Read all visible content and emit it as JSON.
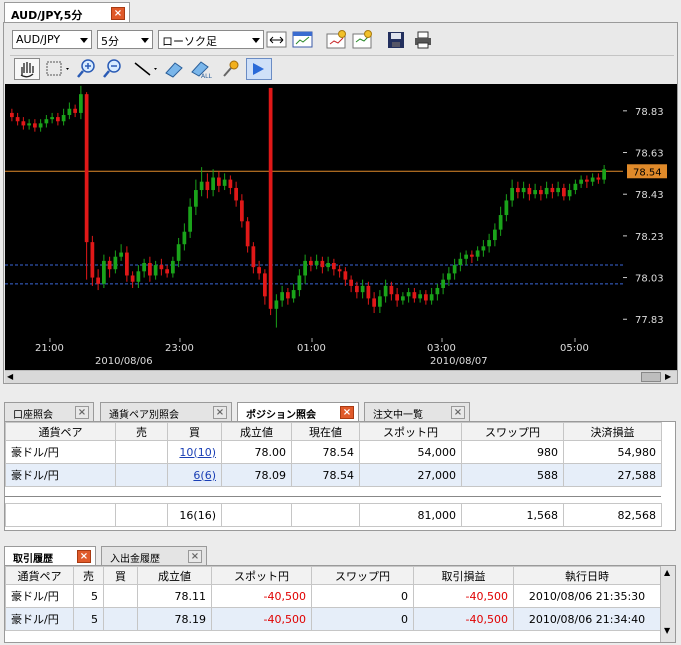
{
  "chart_window": {
    "tab_label": "AUD/JPY,5分",
    "pair_select": "AUD/JPY",
    "interval_select": "5分",
    "chart_type_select": "ローソク足",
    "price_axis_labels": [
      "78.83",
      "78.63",
      "78.43",
      "78.23",
      "78.03",
      "77.83"
    ],
    "current_price_label": "78.54",
    "time_labels": [
      "21:00",
      "23:00",
      "01:00",
      "03:00",
      "05:00"
    ],
    "date_labels": [
      "2010/08/06",
      "2010/08/07"
    ]
  },
  "chart_data": {
    "type": "candlestick",
    "ylim": [
      77.74,
      78.93
    ],
    "current_price": 78.54,
    "reference_lines": [
      78.09,
      78.0
    ],
    "candles": [
      [
        78.82,
        78.8,
        78.84,
        78.78
      ],
      [
        78.8,
        78.78,
        78.82,
        78.76
      ],
      [
        78.78,
        78.76,
        78.8,
        78.74
      ],
      [
        78.76,
        78.77,
        78.79,
        78.74
      ],
      [
        78.77,
        78.75,
        78.79,
        78.73
      ],
      [
        78.75,
        78.77,
        78.79,
        78.73
      ],
      [
        78.77,
        78.79,
        78.81,
        78.75
      ],
      [
        78.79,
        78.8,
        78.82,
        78.77
      ],
      [
        78.8,
        78.78,
        78.82,
        78.76
      ],
      [
        78.78,
        78.81,
        78.84,
        78.76
      ],
      [
        78.81,
        78.84,
        78.87,
        78.79
      ],
      [
        78.84,
        78.82,
        78.86,
        78.8
      ],
      [
        78.82,
        78.91,
        78.95,
        78.79
      ],
      [
        78.91,
        78.2,
        78.92,
        78.02
      ],
      [
        78.2,
        78.03,
        78.23,
        77.99
      ],
      [
        78.03,
        78.0,
        78.07,
        77.97
      ],
      [
        78.0,
        78.11,
        78.14,
        77.98
      ],
      [
        78.11,
        78.07,
        78.13,
        78.03
      ],
      [
        78.07,
        78.13,
        78.16,
        78.05
      ],
      [
        78.13,
        78.15,
        78.19,
        78.11
      ],
      [
        78.15,
        78.04,
        78.18,
        78.01
      ],
      [
        78.04,
        78.01,
        78.06,
        77.98
      ],
      [
        78.01,
        78.06,
        78.09,
        77.98
      ],
      [
        78.06,
        78.1,
        78.12,
        78.03
      ],
      [
        78.1,
        78.04,
        78.13,
        78.01
      ],
      [
        78.04,
        78.09,
        78.11,
        78.02
      ],
      [
        78.09,
        78.07,
        78.12,
        78.04
      ],
      [
        78.07,
        78.05,
        78.09,
        78.03
      ],
      [
        78.05,
        78.11,
        78.13,
        78.03
      ],
      [
        78.11,
        78.19,
        78.22,
        78.08
      ],
      [
        78.19,
        78.25,
        78.29,
        78.16
      ],
      [
        78.25,
        78.37,
        78.41,
        78.22
      ],
      [
        78.37,
        78.45,
        78.5,
        78.33
      ],
      [
        78.45,
        78.49,
        78.56,
        78.42
      ],
      [
        78.49,
        78.45,
        78.53,
        78.41
      ],
      [
        78.45,
        78.51,
        78.55,
        78.42
      ],
      [
        78.51,
        78.47,
        78.54,
        78.44
      ],
      [
        78.47,
        78.5,
        78.53,
        78.45
      ],
      [
        78.5,
        78.46,
        78.52,
        78.43
      ],
      [
        78.46,
        78.4,
        78.49,
        78.37
      ],
      [
        78.4,
        78.3,
        78.43,
        78.27
      ],
      [
        78.3,
        78.18,
        78.32,
        78.15
      ],
      [
        78.18,
        78.08,
        78.2,
        78.05
      ],
      [
        78.08,
        78.05,
        78.11,
        78.02
      ],
      [
        78.05,
        77.94,
        78.07,
        77.9
      ],
      [
        78.94,
        77.88,
        77.97,
        77.85
      ],
      [
        77.88,
        77.92,
        77.95,
        77.79
      ],
      [
        77.92,
        77.96,
        77.99,
        77.89
      ],
      [
        77.96,
        77.93,
        77.98,
        77.9
      ],
      [
        77.93,
        77.97,
        78.0,
        77.91
      ],
      [
        77.97,
        78.04,
        78.07,
        77.94
      ],
      [
        78.04,
        78.11,
        78.14,
        78.0
      ],
      [
        78.11,
        78.09,
        78.13,
        78.06
      ],
      [
        78.09,
        78.11,
        78.14,
        78.07
      ],
      [
        78.11,
        78.08,
        78.13,
        78.05
      ],
      [
        78.08,
        78.1,
        78.13,
        78.06
      ],
      [
        78.1,
        78.07,
        78.12,
        78.04
      ],
      [
        78.07,
        78.06,
        78.09,
        78.03
      ],
      [
        78.06,
        78.02,
        78.08,
        77.99
      ],
      [
        78.02,
        77.99,
        78.04,
        77.96
      ],
      [
        77.99,
        77.96,
        78.01,
        77.93
      ],
      [
        77.96,
        77.99,
        78.02,
        77.93
      ],
      [
        77.99,
        77.93,
        78.01,
        77.9
      ],
      [
        77.93,
        77.89,
        77.96,
        77.86
      ],
      [
        77.89,
        77.94,
        77.97,
        77.86
      ],
      [
        77.94,
        77.99,
        78.02,
        77.91
      ],
      [
        77.99,
        77.95,
        78.01,
        77.92
      ],
      [
        77.95,
        77.92,
        77.98,
        77.89
      ],
      [
        77.92,
        77.94,
        77.96,
        77.9
      ],
      [
        77.94,
        77.96,
        77.98,
        77.91
      ],
      [
        77.96,
        77.93,
        77.98,
        77.91
      ],
      [
        77.93,
        77.95,
        77.97,
        77.91
      ],
      [
        77.95,
        77.92,
        77.97,
        77.9
      ],
      [
        77.92,
        77.95,
        77.98,
        77.9
      ],
      [
        77.95,
        77.98,
        78.0,
        77.92
      ],
      [
        77.98,
        78.02,
        78.05,
        77.95
      ],
      [
        78.02,
        78.05,
        78.08,
        77.99
      ],
      [
        78.05,
        78.09,
        78.12,
        78.02
      ],
      [
        78.09,
        78.12,
        78.15,
        78.06
      ],
      [
        78.12,
        78.14,
        78.16,
        78.09
      ],
      [
        78.14,
        78.13,
        78.16,
        78.1
      ],
      [
        78.13,
        78.16,
        78.18,
        78.11
      ],
      [
        78.16,
        78.18,
        78.21,
        78.13
      ],
      [
        78.18,
        78.21,
        78.24,
        78.15
      ],
      [
        78.21,
        78.26,
        78.29,
        78.18
      ],
      [
        78.26,
        78.33,
        78.37,
        78.23
      ],
      [
        78.33,
        78.4,
        78.43,
        78.3
      ],
      [
        78.4,
        78.46,
        78.5,
        78.37
      ],
      [
        78.46,
        78.44,
        78.49,
        78.41
      ],
      [
        78.44,
        78.46,
        78.49,
        78.41
      ],
      [
        78.46,
        78.43,
        78.48,
        78.4
      ],
      [
        78.43,
        78.45,
        78.48,
        78.41
      ],
      [
        78.45,
        78.43,
        78.47,
        78.4
      ],
      [
        78.43,
        78.46,
        78.49,
        78.41
      ],
      [
        78.46,
        78.44,
        78.48,
        78.41
      ],
      [
        78.44,
        78.46,
        78.49,
        78.42
      ],
      [
        78.46,
        78.42,
        78.48,
        78.4
      ],
      [
        78.42,
        78.45,
        78.48,
        78.4
      ],
      [
        78.45,
        78.48,
        78.5,
        78.43
      ],
      [
        78.48,
        78.5,
        78.52,
        78.46
      ],
      [
        78.5,
        78.49,
        78.52,
        78.46
      ],
      [
        78.49,
        78.51,
        78.53,
        78.47
      ],
      [
        78.51,
        78.5,
        78.53,
        78.48
      ],
      [
        78.5,
        78.55,
        78.57,
        78.48
      ]
    ]
  },
  "position_tabs": [
    {
      "label": "口座照会",
      "active": false
    },
    {
      "label": "通貨ペア別照会",
      "active": false
    },
    {
      "label": "ポジション照会",
      "active": true
    },
    {
      "label": "注文中一覧",
      "active": false
    }
  ],
  "positions": {
    "headers": [
      "通貨ペア",
      "売",
      "買",
      "成立値",
      "現在値",
      "スポット円",
      "スワップ円",
      "決済損益"
    ],
    "rows": [
      [
        "豪ドル/円",
        "",
        "10(10)",
        "78.00",
        "78.54",
        "54,000",
        "980",
        "54,980"
      ],
      [
        "豪ドル/円",
        "",
        "6(6)",
        "78.09",
        "78.54",
        "27,000",
        "588",
        "27,588"
      ]
    ],
    "totals": [
      "",
      "",
      "16(16)",
      "",
      "",
      "81,000",
      "1,568",
      "82,568"
    ]
  },
  "history_tabs": [
    {
      "label": "取引履歴",
      "active": true
    },
    {
      "label": "入出金履歴",
      "active": false
    }
  ],
  "history": {
    "headers": [
      "通貨ペア",
      "売",
      "買",
      "成立値",
      "スポット円",
      "スワップ円",
      "取引損益",
      "執行日時"
    ],
    "rows": [
      [
        "豪ドル/円",
        "5",
        "",
        "78.11",
        "-40,500",
        "0",
        "-40,500",
        "2010/08/06 21:35:30"
      ],
      [
        "豪ドル/円",
        "5",
        "",
        "78.19",
        "-40,500",
        "0",
        "-40,500",
        "2010/08/06 21:34:40"
      ]
    ]
  },
  "colors": {
    "up": "#1aa31a",
    "down": "#e01818",
    "price_line": "#e08a2a",
    "ref_line": "#3a66d8",
    "axis_text": "#dcdcdc"
  }
}
